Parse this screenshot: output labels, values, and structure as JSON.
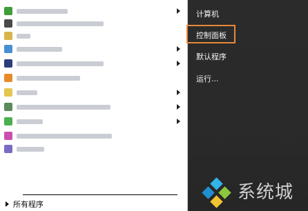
{
  "right_panel": {
    "items": [
      {
        "label": "计算机"
      },
      {
        "label": "控制面板",
        "highlighted": true
      },
      {
        "label": "默认程序"
      },
      {
        "label": "运行..."
      }
    ]
  },
  "left_panel": {
    "programs": [
      {
        "icon": "green-arrow-icon",
        "icon_color": "#3f9e3a",
        "blurred": true,
        "submenu": true
      },
      {
        "icon": "app-icon",
        "icon_color": "#4a4a4a",
        "blurred": true,
        "submenu": false
      },
      {
        "icon": "folder-icon",
        "icon_color": "#d8b54a",
        "blurred": true,
        "submenu": false
      },
      {
        "icon": "web-icon",
        "icon_color": "#4a8fd4",
        "blurred": true,
        "submenu": true
      },
      {
        "icon": "photoshop-icon",
        "icon_color": "#2c3e7a",
        "blurred": true,
        "submenu": true
      },
      {
        "icon": "browser-icon",
        "icon_color": "#e78a2b",
        "blurred": true,
        "submenu": false
      },
      {
        "icon": "paint-icon",
        "icon_color": "#e3c74f",
        "blurred": true,
        "submenu": true
      },
      {
        "icon": "vm-icon",
        "icon_color": "#5b8a5b",
        "blurred": true,
        "submenu": true
      },
      {
        "icon": "chrome-icon",
        "icon_color": "#4caf50",
        "blurred": true,
        "submenu": true
      },
      {
        "icon": "colorful-icon",
        "icon_color": "#c94fb0",
        "blurred": true,
        "submenu": false
      },
      {
        "icon": "app-icon",
        "icon_color": "#7a6bc4",
        "blurred": true,
        "submenu": false
      }
    ],
    "all_programs_label": "所有程序"
  },
  "watermark": {
    "text": "系统城"
  },
  "colors": {
    "highlight_border": "#e8893a",
    "right_background": "#2b2b2b",
    "left_background": "#ffffff"
  }
}
